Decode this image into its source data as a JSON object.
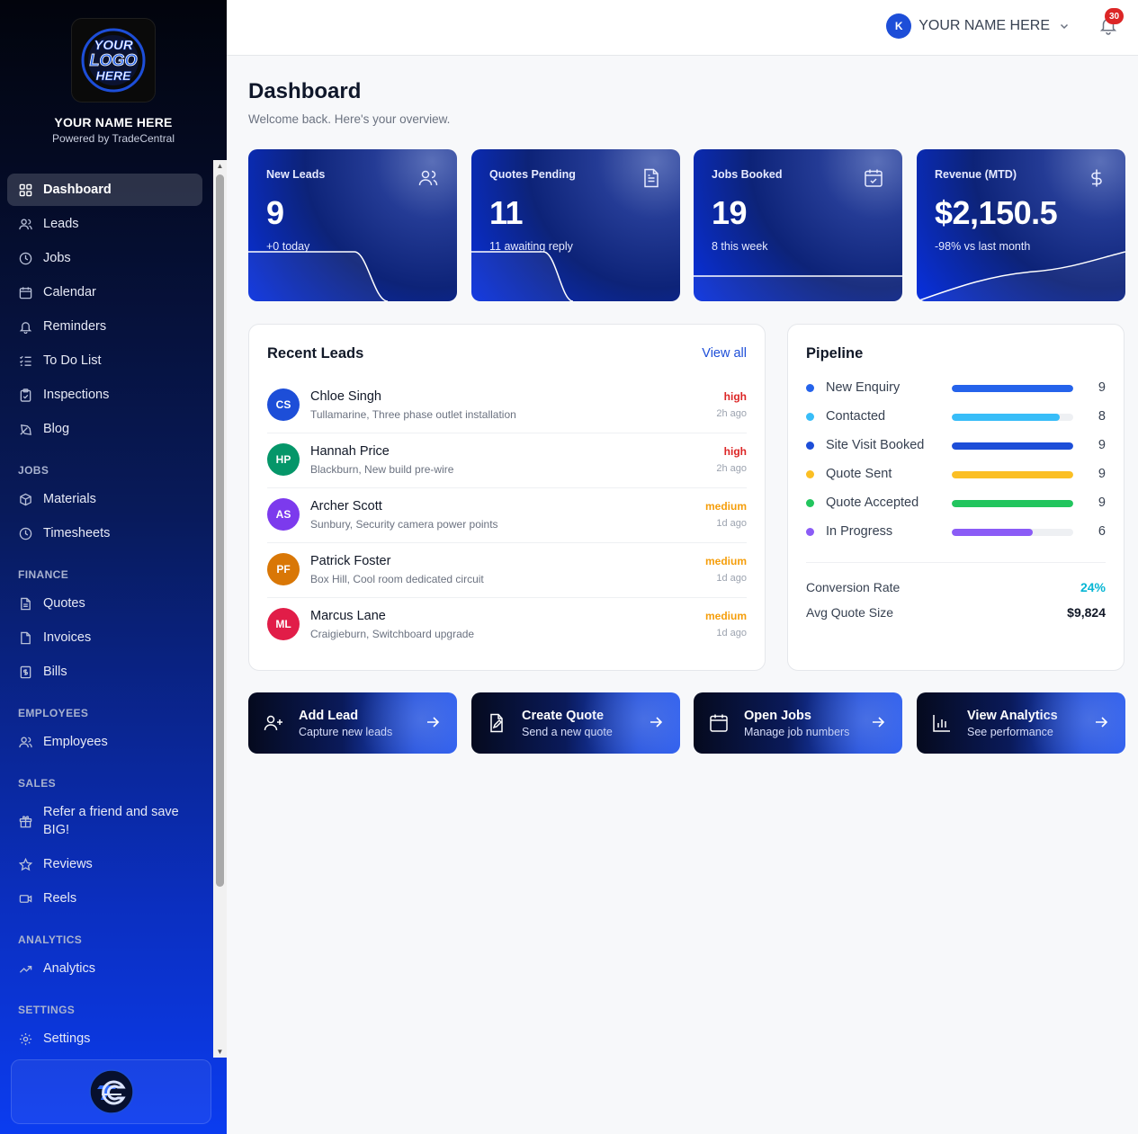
{
  "brand": {
    "logo_text_lines": [
      "YOUR",
      "LOGO",
      "HERE"
    ],
    "name": "YOUR NAME HERE",
    "powered_by": "Powered by TradeCentral"
  },
  "sidebar": {
    "items": [
      {
        "label": "Dashboard",
        "icon": "grid-icon"
      },
      {
        "label": "Leads",
        "icon": "users-icon"
      },
      {
        "label": "Jobs",
        "icon": "clock-icon"
      },
      {
        "label": "Calendar",
        "icon": "calendar-icon"
      },
      {
        "label": "Reminders",
        "icon": "bell-icon"
      },
      {
        "label": "To Do List",
        "icon": "checklist-icon"
      },
      {
        "label": "Inspections",
        "icon": "clipboard-icon"
      },
      {
        "label": "Blog",
        "icon": "feather-icon"
      },
      {
        "label": "Materials",
        "icon": "box-icon"
      },
      {
        "label": "Timesheets",
        "icon": "clock-icon"
      },
      {
        "label": "Quotes",
        "icon": "file-icon"
      },
      {
        "label": "Invoices",
        "icon": "file-icon"
      },
      {
        "label": "Bills",
        "icon": "receipt-icon"
      },
      {
        "label": "Employees",
        "icon": "users-icon"
      },
      {
        "label": "Refer a friend and save BIG!",
        "icon": "gift-icon"
      },
      {
        "label": "Reviews",
        "icon": "star-icon"
      },
      {
        "label": "Reels",
        "icon": "video-icon"
      },
      {
        "label": "Analytics",
        "icon": "trend-icon"
      },
      {
        "label": "Settings",
        "icon": "gear-icon"
      }
    ],
    "sections": [
      "JOBS",
      "FINANCE",
      "EMPLOYEES",
      "SALES",
      "ANALYTICS",
      "SETTINGS"
    ]
  },
  "topbar": {
    "avatar_initial": "K",
    "user_name": "YOUR NAME HERE",
    "notifications": "30"
  },
  "page": {
    "title": "Dashboard",
    "subtitle": "Welcome back. Here's your overview."
  },
  "stats": [
    {
      "label": "New Leads",
      "value": "9",
      "sub": "+0 today",
      "icon": "users-icon"
    },
    {
      "label": "Quotes Pending",
      "value": "11",
      "sub": "11 awaiting reply",
      "icon": "document-icon"
    },
    {
      "label": "Jobs Booked",
      "value": "19",
      "sub": "8 this week",
      "icon": "calendar-check-icon"
    },
    {
      "label": "Revenue (MTD)",
      "value": "$2,150.5",
      "sub": "-98% vs last month",
      "icon": "dollar-icon"
    }
  ],
  "recent_leads": {
    "title": "Recent Leads",
    "view_all": "View all",
    "items": [
      {
        "initials": "CS",
        "name": "Chloe Singh",
        "desc": "Tullamarine, Three phase outlet installation",
        "priority": "high",
        "time": "2h ago",
        "color": "#1d4ed8",
        "priority_color": "#dc2626"
      },
      {
        "initials": "HP",
        "name": "Hannah Price",
        "desc": "Blackburn, New build pre-wire",
        "priority": "high",
        "time": "2h ago",
        "color": "#059669",
        "priority_color": "#dc2626"
      },
      {
        "initials": "AS",
        "name": "Archer Scott",
        "desc": "Sunbury, Security camera power points",
        "priority": "medium",
        "time": "1d ago",
        "color": "#7c3aed",
        "priority_color": "#f59e0b"
      },
      {
        "initials": "PF",
        "name": "Patrick Foster",
        "desc": "Box Hill, Cool room dedicated circuit",
        "priority": "medium",
        "time": "1d ago",
        "color": "#d97706",
        "priority_color": "#f59e0b"
      },
      {
        "initials": "ML",
        "name": "Marcus Lane",
        "desc": "Craigieburn, Switchboard upgrade",
        "priority": "medium",
        "time": "1d ago",
        "color": "#e11d48",
        "priority_color": "#f59e0b"
      }
    ]
  },
  "pipeline": {
    "title": "Pipeline",
    "items": [
      {
        "label": "New Enquiry",
        "count": "9",
        "fraction": 1.0,
        "color": "#2563eb"
      },
      {
        "label": "Contacted",
        "count": "8",
        "fraction": 0.89,
        "color": "#38bdf8"
      },
      {
        "label": "Site Visit Booked",
        "count": "9",
        "fraction": 1.0,
        "color": "#1d4ed8"
      },
      {
        "label": "Quote Sent",
        "count": "9",
        "fraction": 1.0,
        "color": "#fbbf24"
      },
      {
        "label": "Quote Accepted",
        "count": "9",
        "fraction": 1.0,
        "color": "#22c55e"
      },
      {
        "label": "In Progress",
        "count": "6",
        "fraction": 0.67,
        "color": "#8b5cf6"
      }
    ],
    "conversion_label": "Conversion Rate",
    "conversion_value": "24%",
    "avg_quote_label": "Avg Quote Size",
    "avg_quote_value": "$9,824"
  },
  "actions": [
    {
      "title": "Add Lead",
      "sub": "Capture new leads",
      "icon": "user-plus-icon"
    },
    {
      "title": "Create Quote",
      "sub": "Send a new quote",
      "icon": "file-edit-icon"
    },
    {
      "title": "Open Jobs",
      "sub": "Manage job numbers",
      "icon": "calendar-icon"
    },
    {
      "title": "View Analytics",
      "sub": "See performance",
      "icon": "bar-chart-icon"
    }
  ]
}
